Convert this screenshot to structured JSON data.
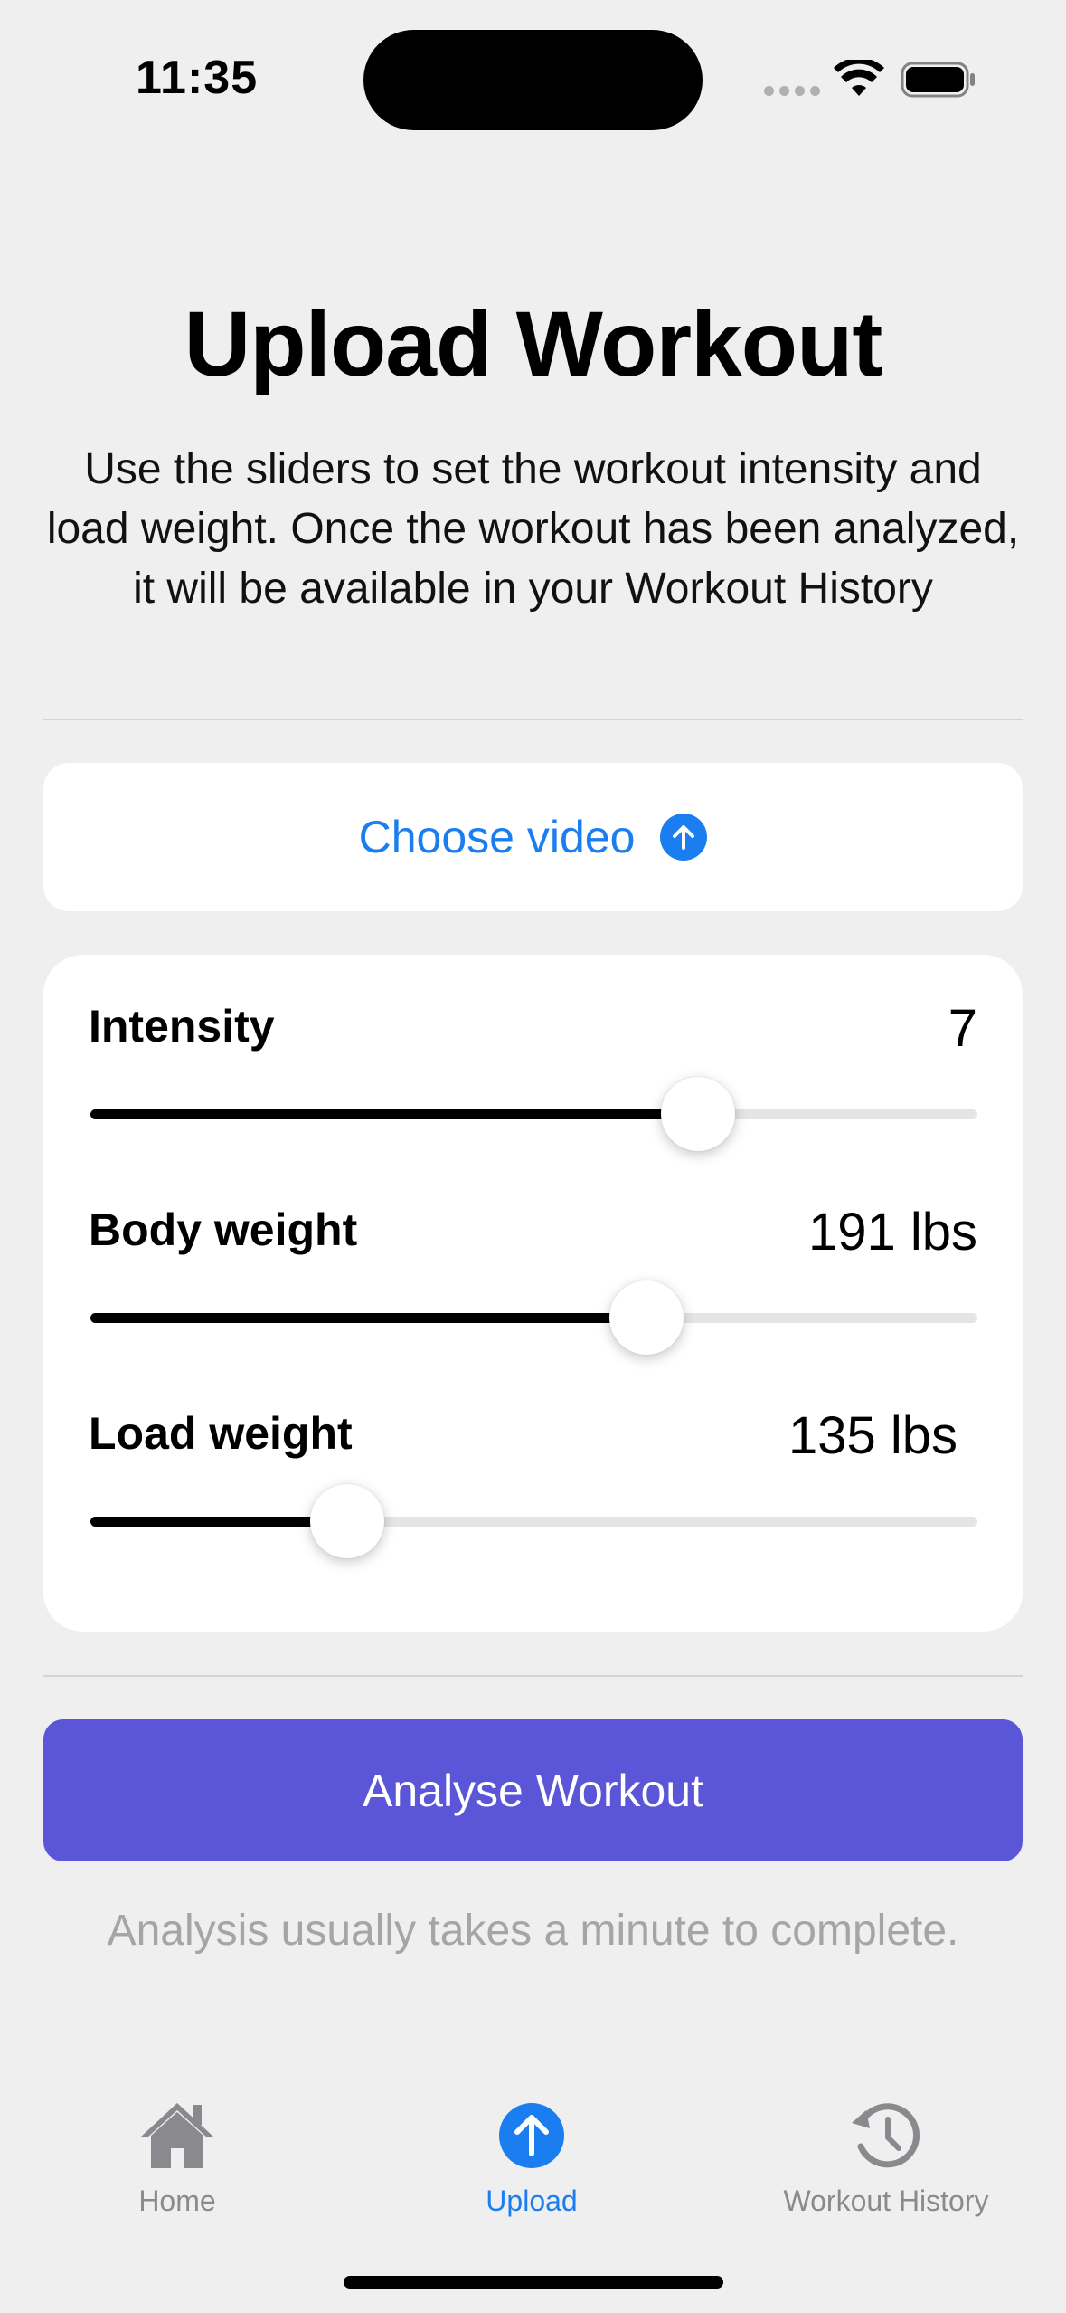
{
  "status_bar": {
    "time": "11:35"
  },
  "header": {
    "title": "Upload Workout",
    "description": "Use the sliders to set the workout intensity and load weight. Once the workout has been analyzed, it will be available in your Workout History"
  },
  "choose_video": {
    "label": "Choose video",
    "icon": "arrow-up-circle-icon"
  },
  "sliders": [
    {
      "label": "Intensity",
      "value": "7",
      "fill_percent": 68.5
    },
    {
      "label": "Body weight",
      "value": "191 lbs",
      "fill_percent": 62.7
    },
    {
      "label": "Load weight",
      "value": "135 lbs",
      "fill_percent": 29.0
    }
  ],
  "analyse_button": {
    "label": "Analyse Workout",
    "color": "#5b56d7"
  },
  "analysis_note": "Analysis usually takes a minute to complete.",
  "tab_bar": {
    "active": "Upload",
    "items": [
      {
        "label": "Home",
        "icon": "house-icon"
      },
      {
        "label": "Upload",
        "icon": "arrow-up-circle-icon"
      },
      {
        "label": "Workout History",
        "icon": "history-clock-icon"
      }
    ]
  },
  "colors": {
    "accent": "#1a7df0",
    "background": "#efeff0",
    "inactive_tab": "#8a8a8e"
  }
}
